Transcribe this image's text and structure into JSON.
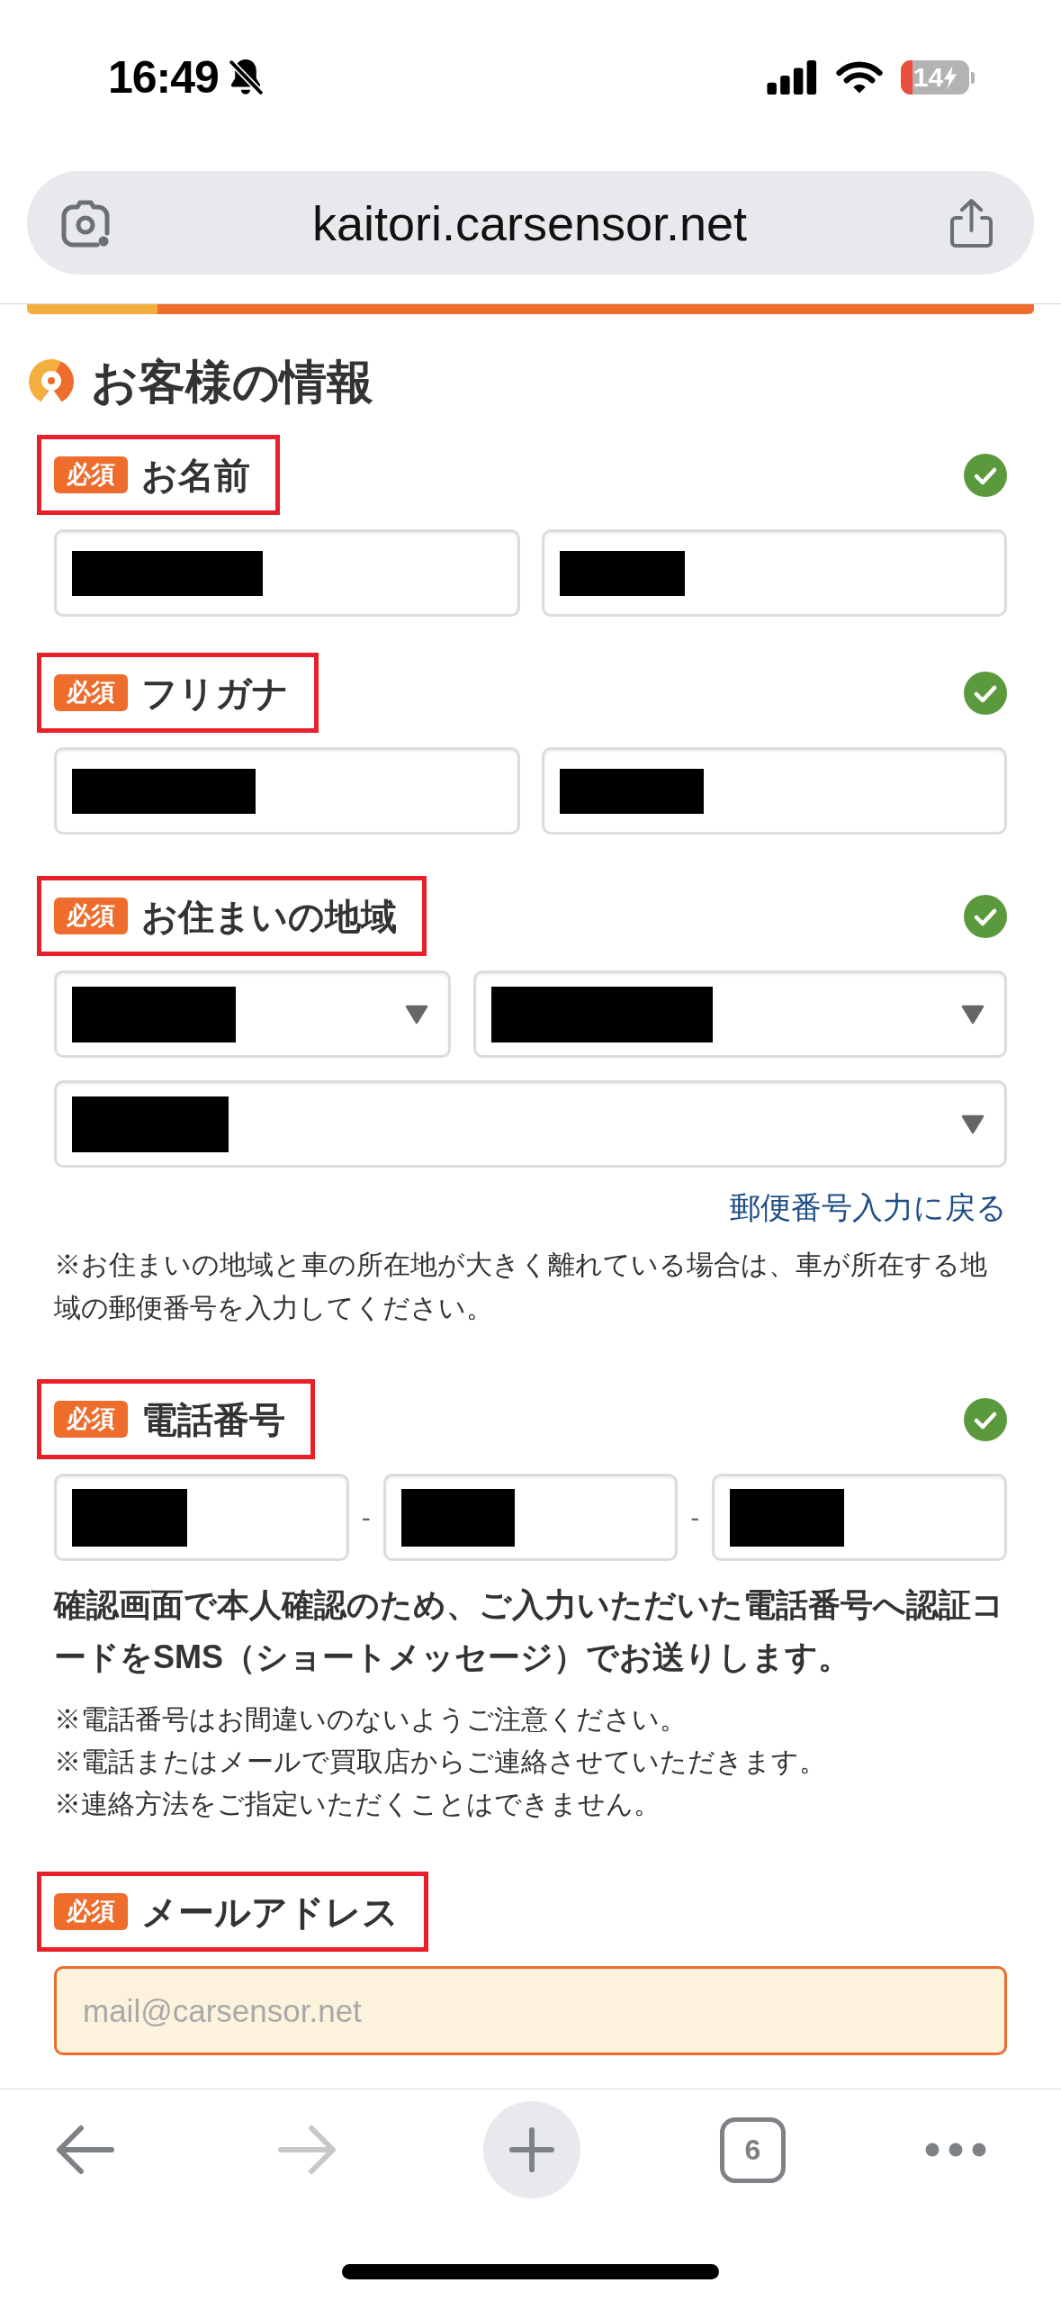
{
  "status_bar": {
    "time": "16:49",
    "silent": true,
    "battery": "14"
  },
  "address_bar": {
    "url": "kaitori.carsensor.net"
  },
  "section": {
    "title": "お客様の情報",
    "fields": [
      {
        "kind": "pair",
        "badge": "必須",
        "label": "お名前",
        "outlined": true,
        "valid": true,
        "inputs": [
          {
            "redacted": true
          },
          {
            "redacted": true
          }
        ]
      },
      {
        "kind": "pair",
        "badge": "必須",
        "label": "フリガナ",
        "outlined": true,
        "valid": true,
        "inputs": [
          {
            "redacted": true
          },
          {
            "redacted": true
          }
        ]
      },
      {
        "kind": "address",
        "badge": "必須",
        "label": "お住まいの地域",
        "outlined": true,
        "valid": true,
        "selects": [
          {
            "redacted": true
          },
          {
            "redacted": true
          },
          {
            "redacted": true
          }
        ],
        "link": "郵便番号入力に戻る",
        "note": "※お住まいの地域と車の所在地が大きく離れている場合は、車が所在する地域の郵便番号を入力してください。"
      },
      {
        "kind": "phone",
        "badge": "必須",
        "label": "電話番号",
        "outlined": true,
        "valid": true,
        "inputs": [
          {
            "redacted": true
          },
          {
            "redacted": true
          },
          {
            "redacted": true
          }
        ],
        "separators": [
          "-",
          "-"
        ],
        "notice": "確認画面で本人確認のため、ご入力いただいた電話番号へ認証コードをSMS（ショートメッセージ）でお送りします。",
        "notes": [
          "※電話番号はお間違いのないようご注意ください。",
          "※電話またはメールで買取店からご連絡させていただきます。",
          "※連絡方法をご指定いただくことはできません。"
        ]
      },
      {
        "kind": "email",
        "badge": "必須",
        "label": "メールアドレス",
        "outlined": true,
        "valid": false,
        "input": {
          "placeholder": "mail@carsensor.net",
          "attention": true
        }
      }
    ]
  },
  "toolbar": {
    "buttons": [
      {
        "kind": "back",
        "disabled": false
      },
      {
        "kind": "forward",
        "disabled": true
      },
      {
        "kind": "new_tab",
        "disabled": false
      },
      {
        "kind": "tabs",
        "label": "6",
        "disabled": false
      },
      {
        "kind": "more",
        "disabled": false
      }
    ]
  }
}
